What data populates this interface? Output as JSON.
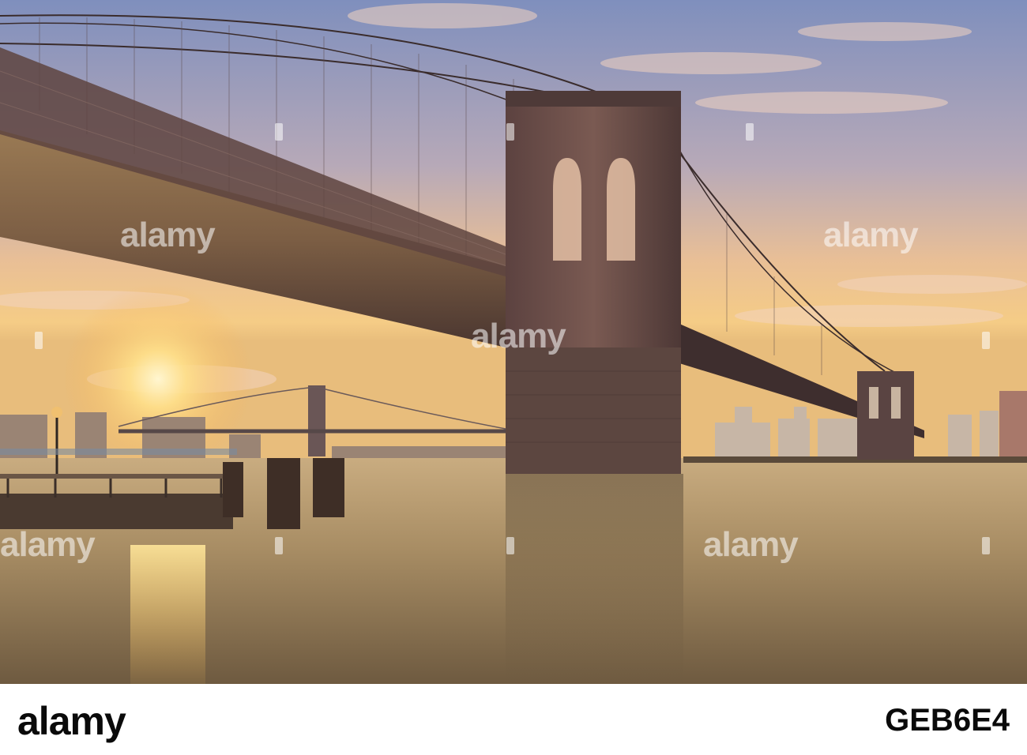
{
  "photo": {
    "subject": ""
  },
  "watermark": {
    "text": "alamy"
  },
  "footer": {
    "logo_text": "alamy",
    "image_id": "GEB6E4"
  },
  "colors": {
    "sky_top": "#8a98c4",
    "sky_horizon": "#f3c27a",
    "sun": "#ffe7a0",
    "water": "#b79a6a",
    "bridge_stone": "#6f5048",
    "bridge_dark": "#3a2a2a",
    "footer_text": "#0a0a0a"
  }
}
